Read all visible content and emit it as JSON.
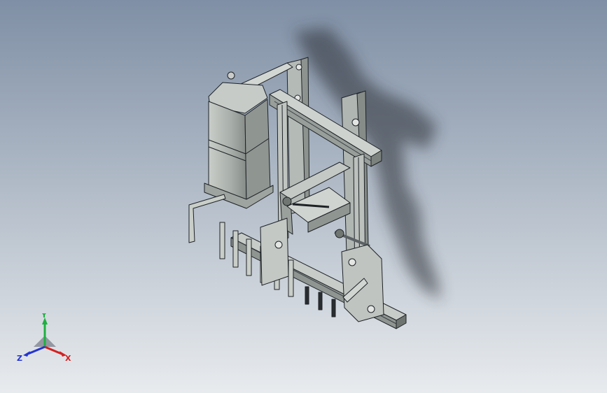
{
  "viewport": {
    "background_top": "#7f8fa5",
    "background_bottom": "#e8ebee"
  },
  "model": {
    "part_color": "#a4aaa6",
    "edge_color": "#1e2226",
    "shadow_color": "#2a2f35"
  },
  "triad": {
    "x_label": "X",
    "y_label": "Y",
    "z_label": "Z",
    "x_color": "#d42020",
    "y_color": "#1fb040",
    "z_color": "#2434d0"
  }
}
